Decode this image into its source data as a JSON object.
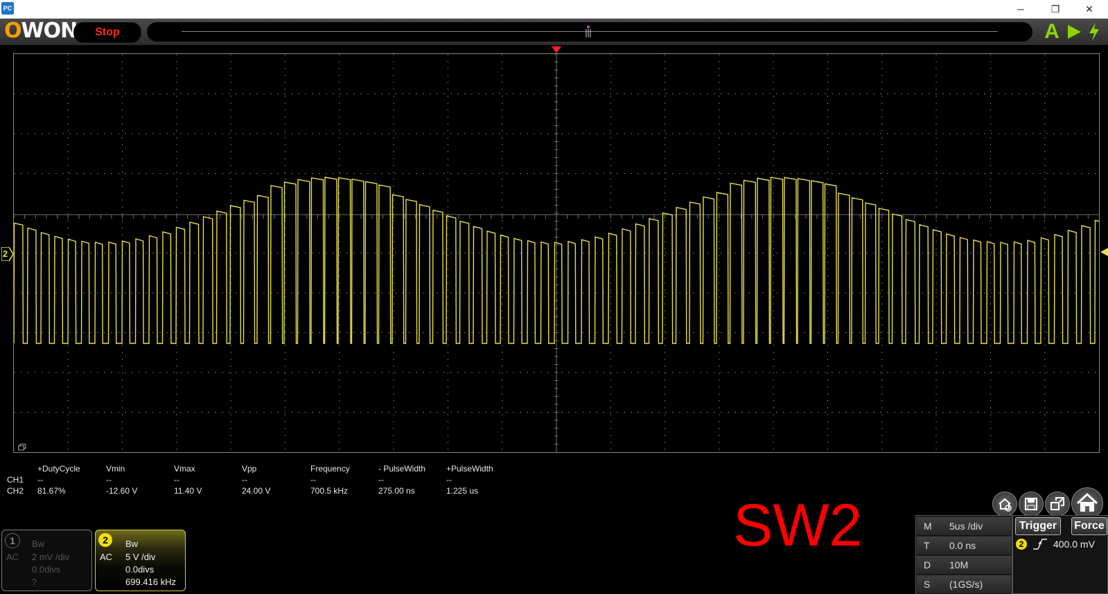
{
  "window": {
    "icon_label": "PC",
    "minimize_glyph": "─",
    "restore_glyph": "❐",
    "close_glyph": "✕"
  },
  "toolbar": {
    "logo_first": "O",
    "logo_rest": "WON",
    "run_state": "Stop",
    "auto_label": "A"
  },
  "screen": {
    "ch2_marker": "2",
    "trace_color": "#e8e04a",
    "grid_color": "#6e6e6e"
  },
  "measurements": {
    "row_labels": [
      "CH1",
      "CH2"
    ],
    "columns": [
      {
        "header": "+DutyCycle",
        "ch1": "--",
        "ch2": "81.67%"
      },
      {
        "header": "Vmin",
        "ch1": "--",
        "ch2": "-12.60 V"
      },
      {
        "header": "Vmax",
        "ch1": "--",
        "ch2": "11.40 V"
      },
      {
        "header": "Vpp",
        "ch1": "--",
        "ch2": "24.00 V"
      },
      {
        "header": "Frequency",
        "ch1": "--",
        "ch2": "700.5 kHz"
      },
      {
        "header": "- PulseWidth",
        "ch1": "--",
        "ch2": "275.00 ns"
      },
      {
        "header": "+PulseWidth",
        "ch1": "--",
        "ch2": "1.225 us"
      }
    ]
  },
  "annotation": {
    "label": "SW2"
  },
  "channels": {
    "ch1": {
      "number": "1",
      "bw": "Bw",
      "coupling": "AC",
      "scale": "2 mV /div",
      "offset": "0.0divs",
      "freq": "?"
    },
    "ch2": {
      "number": "2",
      "bw": "Bw",
      "coupling": "AC",
      "scale": "5 V /div",
      "offset": "0.0divs",
      "freq": "699.416 kHz"
    }
  },
  "timebase": {
    "rows": [
      {
        "key": "M",
        "value": "5us /div"
      },
      {
        "key": "T",
        "value": "0.0 ns"
      },
      {
        "key": "D",
        "value": "10M"
      },
      {
        "key": "S",
        "value": "(1GS/s)"
      }
    ]
  },
  "trigger": {
    "trigger_label": "Trigger",
    "force_label": "Force",
    "source": "2",
    "level": "400.0 mV"
  }
}
